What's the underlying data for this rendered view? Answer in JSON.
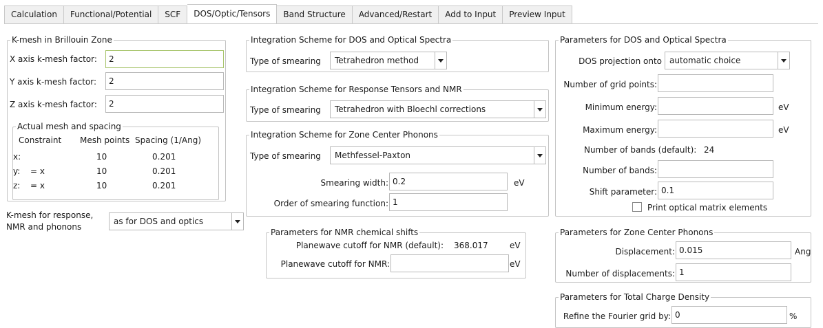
{
  "tabs": [
    "Calculation",
    "Functional/Potential",
    "SCF",
    "DOS/Optic/Tensors",
    "Band Structure",
    "Advanced/Restart",
    "Add to Input",
    "Preview Input"
  ],
  "kmesh": {
    "title": "K-mesh in Brillouin Zone",
    "x_label": "X axis k-mesh factor:",
    "x_value": "2",
    "y_label": "Y axis k-mesh factor:",
    "y_value": "2",
    "z_label": "Z axis k-mesh factor:",
    "z_value": "2",
    "actual": {
      "title": "Actual mesh and spacing",
      "headers": [
        "Constraint",
        "Mesh points",
        "Spacing (1/Ang)"
      ],
      "rows": [
        {
          "axis": "x:",
          "constraint": "",
          "points": "10",
          "spacing": "0.201"
        },
        {
          "axis": "y:",
          "constraint": "= x",
          "points": "10",
          "spacing": "0.201"
        },
        {
          "axis": "z:",
          "constraint": "= x",
          "points": "10",
          "spacing": "0.201"
        }
      ]
    },
    "response_label_1": "K-mesh for response,",
    "response_label_2": "NMR and phonons",
    "response_value": "as for DOS and optics"
  },
  "dos_scheme": {
    "title": "Integration Scheme for DOS and Optical Spectra",
    "smearing_label": "Type of smearing",
    "smearing_value": "Tetrahedron method"
  },
  "resp_scheme": {
    "title": "Integration Scheme for Response Tensors and NMR",
    "smearing_label": "Type of smearing",
    "smearing_value": "Tetrahedron with Bloechl corrections"
  },
  "phonon_scheme": {
    "title": "Integration Scheme for Zone Center Phonons",
    "smearing_label": "Type of smearing",
    "smearing_value": "Methfessel-Paxton",
    "width_label": "Smearing width:",
    "width_value": "0.2",
    "width_unit": "eV",
    "order_label": "Order of smearing function:",
    "order_value": "1"
  },
  "nmr": {
    "title": "Parameters for NMR chemical shifts",
    "default_label": "Planewave cutoff for NMR (default):",
    "default_value": "368.017",
    "default_unit": "eV",
    "cutoff_label": "Planewave cutoff for NMR:",
    "cutoff_value": "",
    "cutoff_unit": "eV"
  },
  "dos_params": {
    "title": "Parameters for DOS and Optical Spectra",
    "projection_label": "DOS projection onto",
    "projection_value": "automatic choice",
    "grid_label": "Number of grid points:",
    "grid_value": "",
    "min_label": "Minimum energy:",
    "min_value": "",
    "min_unit": "eV",
    "max_label": "Maximum energy:",
    "max_value": "",
    "max_unit": "eV",
    "bands_default_label": "Number of bands (default):",
    "bands_default_value": "24",
    "bands_label": "Number of bands:",
    "bands_value": "",
    "shift_label": "Shift parameter:",
    "shift_value": "0.1",
    "print_label": "Print optical matrix elements"
  },
  "zc_phonons": {
    "title": "Parameters for Zone Center Phonons",
    "disp_label": "Displacement:",
    "disp_value": "0.015",
    "disp_unit": "Ang",
    "ndisp_label": "Number of displacements:",
    "ndisp_value": "1"
  },
  "charge": {
    "title": "Parameters for Total Charge Density",
    "refine_label": "Refine the Fourier grid by:",
    "refine_value": "0",
    "refine_unit": "%"
  },
  "colors": {
    "focus_border": "#a7c46b",
    "tab_bg": "#f0f0f0",
    "border": "#c4c4c4"
  }
}
